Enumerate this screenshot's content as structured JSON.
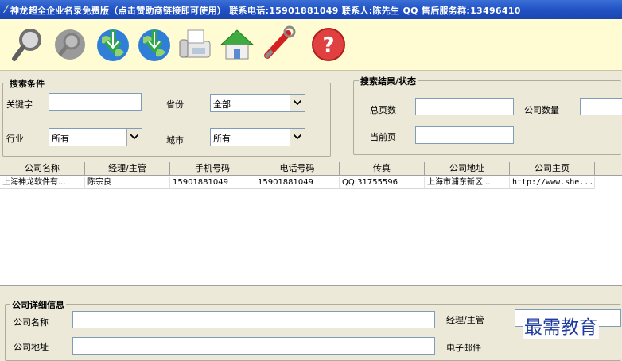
{
  "titlebar": {
    "text": "神龙超全企业名录免费版（点击赞助商链接即可使用） 联系电话:15901881049 联系人:陈先生 QQ 售后服务群:13496410"
  },
  "toolbar": {
    "icons": [
      "search-icon",
      "disabled-search-icon",
      "globe-download-icon",
      "globe-export-icon",
      "fax-icon",
      "home-icon",
      "settings-wrench-icon",
      "help-icon"
    ]
  },
  "search": {
    "legend": "搜索条件",
    "keyword_label": "关键字",
    "keyword_value": "",
    "province_label": "省份",
    "province_value": "全部",
    "industry_label": "行业",
    "industry_value": "所有",
    "city_label": "城市",
    "city_value": "所有"
  },
  "result": {
    "legend": "搜索结果/状态",
    "total_pages_label": "总页数",
    "company_count_label": "公司数量",
    "current_page_label": "当前页"
  },
  "table": {
    "columns": [
      "公司名称",
      "经理/主管",
      "手机号码",
      "电话号码",
      "传真",
      "公司地址",
      "公司主页"
    ],
    "rows": [
      [
        "上海神龙软件有...",
        "陈宗良",
        "15901881049",
        "15901881049",
        "QQ:31755596",
        "上海市浦东新区...",
        "http://www.she..."
      ]
    ]
  },
  "detail": {
    "legend": "公司详细信息",
    "company_name_label": "公司名称",
    "manager_label": "经理/主管",
    "address_label": "公司地址",
    "email_label": "电子邮件"
  },
  "watermark": "最需教育"
}
